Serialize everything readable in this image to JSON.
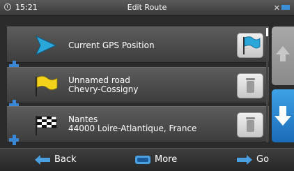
{
  "status_bar": {
    "time": "15:21",
    "title": "Edit Route",
    "clock_icon": "clock-icon",
    "satellite_icon": "satellite-icon",
    "battery_icon": "battery-icon"
  },
  "route": {
    "waypoints": [
      {
        "line1": "Current GPS Position",
        "line2": "",
        "flag_color": "#2aa6d8",
        "action": "flag"
      },
      {
        "line1": "Unnamed road",
        "line2": "Chevry-Cossigny",
        "flag_color": "#f2d21b",
        "action": "delete"
      },
      {
        "line1": "Nantes",
        "line2": "44000 Loire-Atlantique, France",
        "flag_color": "checkered",
        "action": "delete"
      }
    ]
  },
  "toolbar": {
    "back_label": "Back",
    "more_label": "More",
    "go_label": "Go"
  },
  "colors": {
    "accent_blue": "#3a87d6",
    "panel_gray": "#4a4a4a",
    "down_button": "#2a86d0"
  }
}
